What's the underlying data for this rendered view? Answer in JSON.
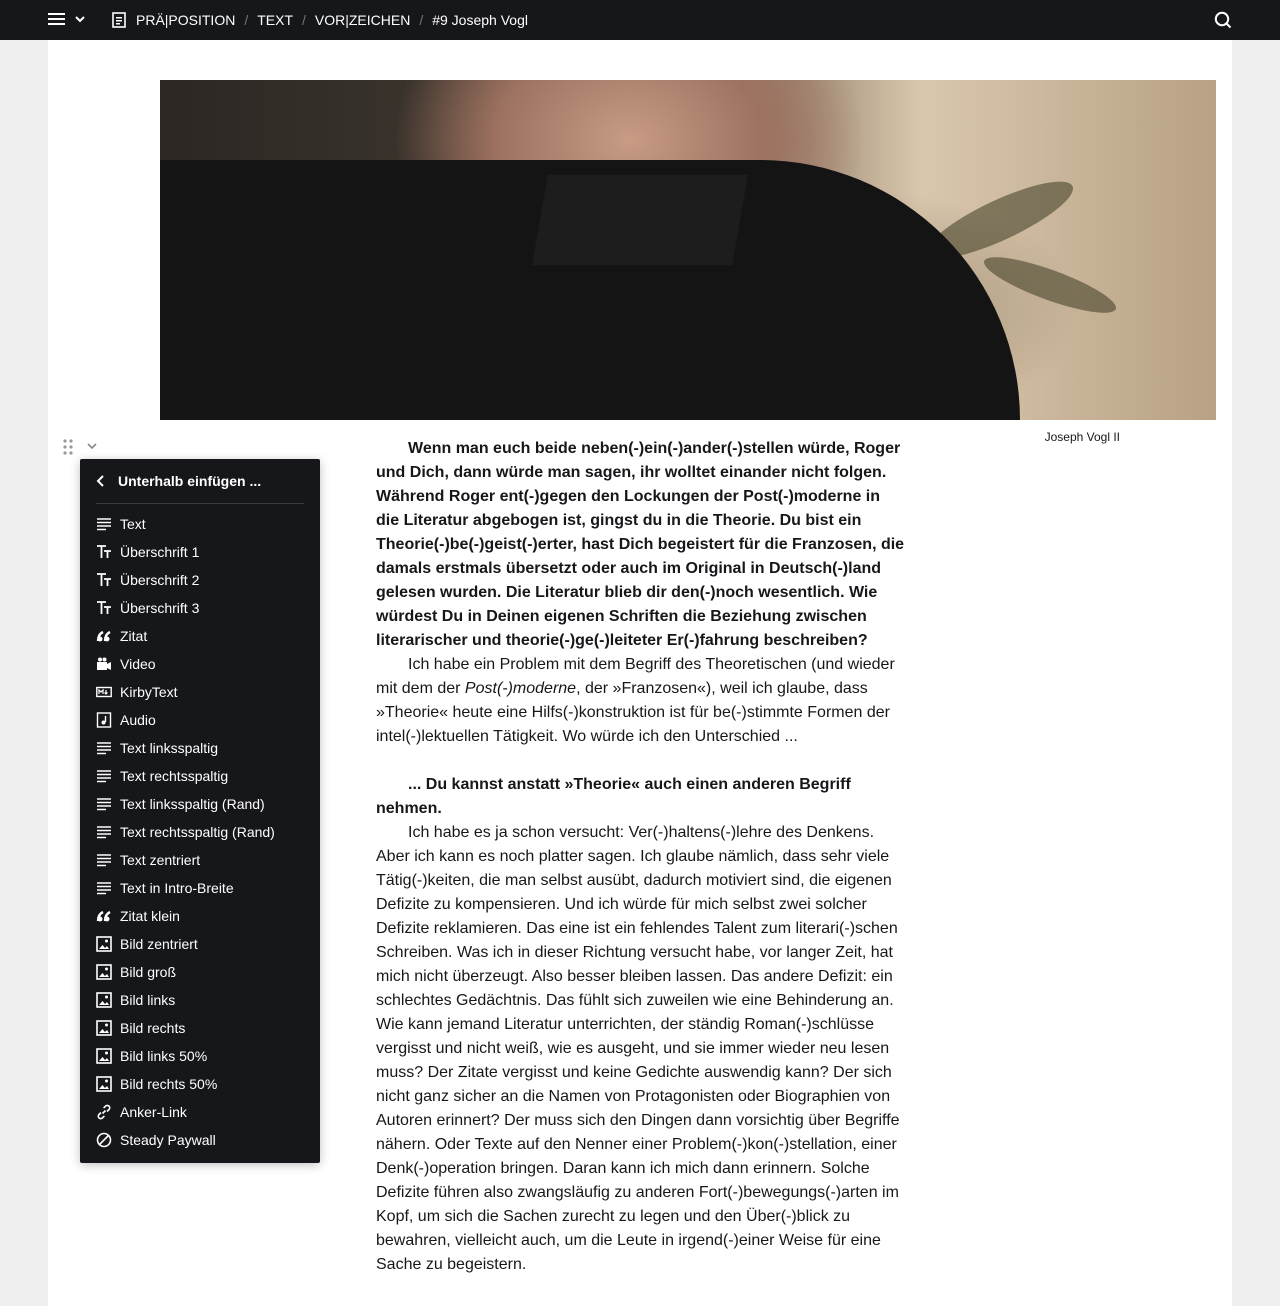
{
  "topbar": {
    "crumbs": [
      "PRÄ|POSITION",
      "TEXT",
      "VOR|ZEICHEN",
      "#9 Joseph Vogl"
    ]
  },
  "image": {
    "caption": "Joseph Vogl II",
    "description_icon": "portrait-photo"
  },
  "dropdown": {
    "header": "Unterhalb einfügen ...",
    "items": [
      {
        "label": "Text",
        "icon": "text-icon"
      },
      {
        "label": "Überschrift 1",
        "icon": "title-icon"
      },
      {
        "label": "Überschrift 2",
        "icon": "title-icon"
      },
      {
        "label": "Überschrift 3",
        "icon": "title-icon"
      },
      {
        "label": "Zitat",
        "icon": "quote-icon"
      },
      {
        "label": "Video",
        "icon": "video-icon"
      },
      {
        "label": "KirbyText",
        "icon": "markdown-icon"
      },
      {
        "label": "Audio",
        "icon": "audio-icon"
      },
      {
        "label": "Text linksspaltig",
        "icon": "text-icon"
      },
      {
        "label": "Text rechtsspaltig",
        "icon": "text-icon"
      },
      {
        "label": "Text linksspaltig (Rand)",
        "icon": "text-icon"
      },
      {
        "label": "Text rechtsspaltig (Rand)",
        "icon": "text-icon"
      },
      {
        "label": "Text zentriert",
        "icon": "text-icon"
      },
      {
        "label": "Text in Intro-Breite",
        "icon": "text-icon"
      },
      {
        "label": "Zitat klein",
        "icon": "quote-icon"
      },
      {
        "label": "Bild zentriert",
        "icon": "image-icon"
      },
      {
        "label": "Bild groß",
        "icon": "image-icon"
      },
      {
        "label": "Bild links",
        "icon": "image-icon"
      },
      {
        "label": "Bild rechts",
        "icon": "image-icon"
      },
      {
        "label": "Bild links 50%",
        "icon": "image-icon"
      },
      {
        "label": "Bild rechts 50%",
        "icon": "image-icon"
      },
      {
        "label": "Anker-Link",
        "icon": "link-icon"
      },
      {
        "label": "Steady Paywall",
        "icon": "cancel-icon"
      }
    ]
  },
  "article": {
    "q1": "Wenn man euch beide neben(-)ein(-)ander(-)stellen würde, Roger und Dich, dann würde man sagen, ihr wolltet einander nicht folgen. Während Roger ent(-)gegen den Lockungen der Post(-)moderne in die Literatur abgebogen ist, gingst du in die Theorie. Du bist ein Theorie(-)be(-)geist(-)erter, hast Dich begeistert für die Franzosen, die damals erstmals übersetzt oder auch im Original in Deutsch(-)land gelesen wurden. Die Literatur blieb dir den(-)noch wesentlich. Wie würdest Du in Deinen eigenen Schriften die Beziehung zwischen literarischer und theorie(-)ge(-)leiteter Er(-)fahrung beschreiben?",
    "a1_before": "Ich habe ein Problem mit dem Begriff des Theoretischen (und wieder mit dem der ",
    "a1_italic": "Post(-)moderne",
    "a1_after": ", der »Franzosen«), weil ich glaube, dass »Theorie« heute eine Hilfs(-)konstruktion ist für be(-)stimmte Formen der intel(-)lektuellen Tätigkeit. Wo würde ich den Unterschied ...",
    "q2": "... Du kannst anstatt »Theorie« auch einen anderen Begriff nehmen.",
    "a2": "Ich habe es ja schon versucht: Ver(-)haltens(-)lehre des Denkens. Aber ich kann es noch platter sagen. Ich glaube nämlich, dass sehr viele Tätig(-)keiten, die man selbst ausübt, dadurch motiviert sind, die eigenen Defizite zu kompensieren. Und ich würde für mich selbst zwei solcher Defizite reklamieren. Das eine ist ein fehlendes Talent zum literari(-)schen Schreiben. Was ich in dieser Richtung versucht habe, vor langer Zeit, hat mich nicht überzeugt. Also besser bleiben lassen. Das andere Defizit: ein schlechtes Gedächtnis. Das fühlt sich zuweilen wie eine Behinderung an. Wie kann jemand Literatur unterrichten, der ständig Roman(-)schlüsse vergisst und nicht weiß, wie es ausgeht, und sie immer wieder neu lesen muss? Der Zitate vergisst und keine Gedichte auswendig kann? Der sich nicht ganz sicher an die Namen von Protagonisten oder Biographien von Autoren erinnert? Der muss sich den Dingen dann vorsichtig über Begriffe nähern. Oder Texte auf den Nenner einer Problem(-)kon(-)stellation, einer Denk(-)operation bringen. Daran kann ich mich dann erinnern. Solche Defizite führen also zwangsläufig zu anderen Fort(-)bewegungs(-)arten im Kopf, um sich die Sachen zurecht zu legen und den Über(-)blick zu bewahren, vielleicht auch, um die Leute in irgend(-)einer Weise für eine Sache zu begeistern."
  }
}
